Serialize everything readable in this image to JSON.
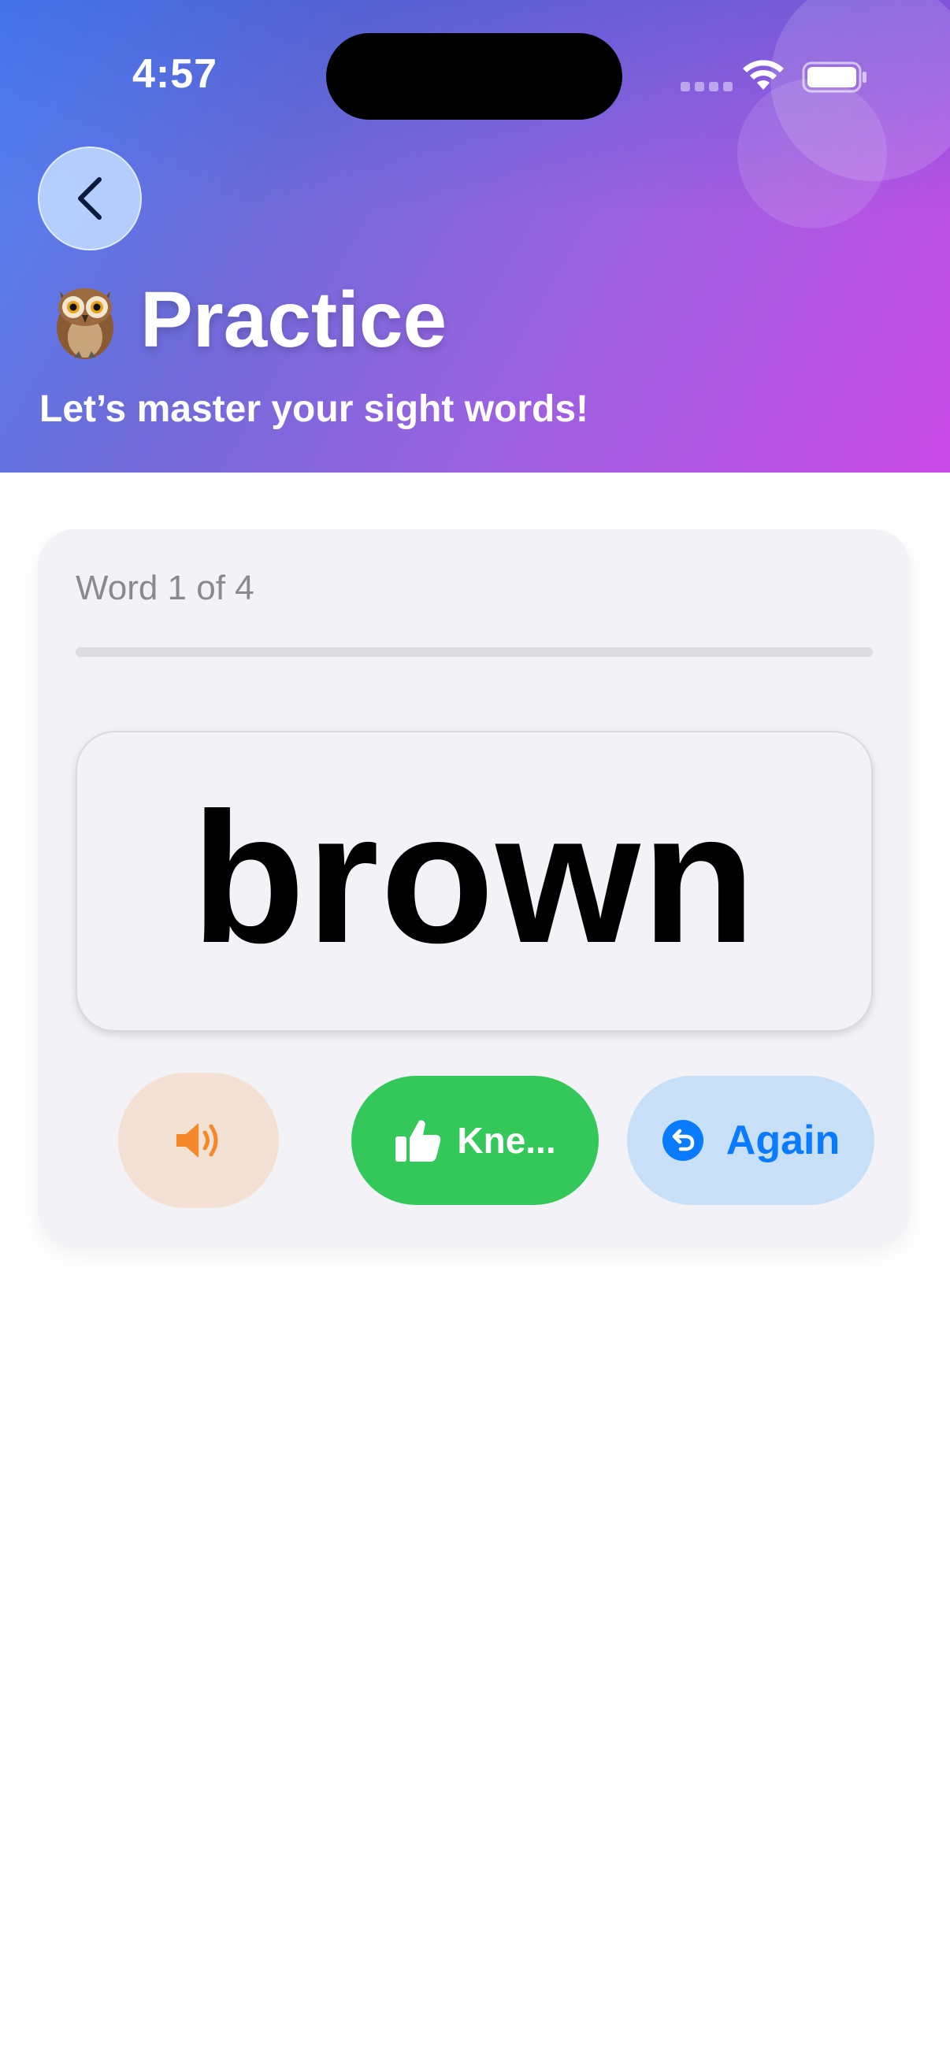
{
  "status_bar": {
    "time": "4:57"
  },
  "header": {
    "title": "Practice",
    "subtitle": "Let’s master your sight words!",
    "title_icon": "owl-emoji"
  },
  "practice": {
    "counter": "Word 1 of 4",
    "progress_fraction": 0,
    "current_word": "brown"
  },
  "buttons": {
    "speak_icon": "speaker-icon",
    "knew_label": "Kne...",
    "knew_icon": "thumbs-up-icon",
    "again_label": "Again",
    "again_icon": "undo-circle-icon"
  },
  "colors": {
    "knew_green": "#34c759",
    "again_blue": "#0a7aff",
    "speak_orange": "#f5892a"
  }
}
